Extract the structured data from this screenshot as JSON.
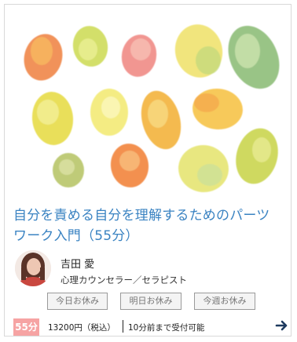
{
  "course": {
    "title_line1": "自分を責める自分を理解するためのパーツ",
    "title_line2": "ワーク入門（55分）"
  },
  "instructor": {
    "name": "吉田 愛",
    "role": "心理カウンセラー／セラピスト"
  },
  "availability_tags": [
    "今日お休み",
    "明日お休み",
    "今週お休み"
  ],
  "footer": {
    "duration_badge": "55分",
    "price": "13200円（税込）",
    "deadline": "10分前まで受付可能"
  },
  "colors": {
    "title": "#3a83c2",
    "duration_badge": "#f6a3a3",
    "arrow": "#1e3a5f"
  },
  "icons": {
    "next": "arrow-right-icon"
  }
}
